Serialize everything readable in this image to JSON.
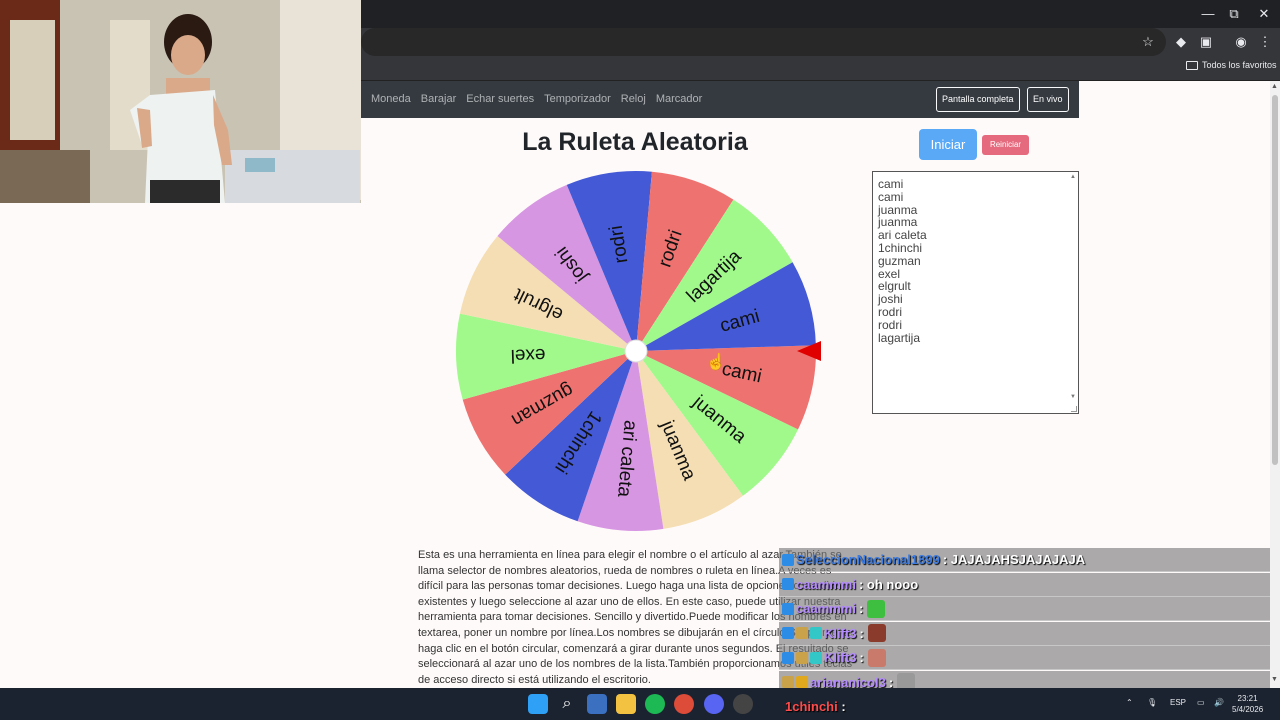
{
  "browser": {
    "win_min": "—",
    "win_max": "⧉",
    "win_close": "✕",
    "bookmarks_label": "Todos los favoritos"
  },
  "navbar": {
    "links": [
      "Moneda",
      "Barajar",
      "Echar suertes",
      "Temporizador",
      "Reloj",
      "Marcador"
    ],
    "fullscreen_label": "Pantalla completa",
    "live_label": "En vivo"
  },
  "main": {
    "title": "La Ruleta Aleatoria",
    "start_label": "Iniciar",
    "reset_label": "Reiniciar",
    "names_text": "cami\ncami\njuanma\njuanma\nari caleta\n1chinchi\nguzman\nexel\nelgrult\njoshi\nrodri\nrodri\nlagartija",
    "description": "Esta es una herramienta en línea para elegir el nombre o el artículo al azar.También se llama selector de nombres aleatorios, rueda de nombres o ruleta en línea.A veces es difícil para las personas tomar decisiones. Luego haga una lista de opciones o candidatos existentes y luego seleccione al azar uno de ellos. En este caso, puede utilizar nuestra herramienta para tomar decisiones. Sencillo y divertido.Puede modificar los nombres en textarea, poner un nombre por línea.Los nombres se dibujarán en el círculo.Simplemente haga clic en el botón circular, comenzará a girar durante unos segundos. El resultado se seleccionará al azar uno de los nombres de la lista.También proporcionamos útiles teclas de acceso directo si está utilizando el escritorio."
  },
  "wheel": {
    "rotation_deg": 12,
    "segments": [
      {
        "label": "cami",
        "color": "#ee7370"
      },
      {
        "label": "juanma",
        "color": "#a1f98c"
      },
      {
        "label": "juanma",
        "color": "#f5deb3"
      },
      {
        "label": "ari caleta",
        "color": "#d796e2"
      },
      {
        "label": "1chinchi",
        "color": "#4359d6"
      },
      {
        "label": "guzman",
        "color": "#ee7370"
      },
      {
        "label": "exel",
        "color": "#a1f98c"
      },
      {
        "label": "elgrult",
        "color": "#f5deb3"
      },
      {
        "label": "joshi",
        "color": "#d796e2"
      },
      {
        "label": "rodri",
        "color": "#4359d6"
      },
      {
        "label": "rodri",
        "color": "#ee7370"
      },
      {
        "label": "lagartija",
        "color": "#a1f98c"
      },
      {
        "label": "cami",
        "color": "#4359d6"
      }
    ],
    "pointer_color": "#e00000"
  },
  "chat": [
    {
      "user": "SeleccionNacional1899",
      "user_color": "#3d7be0",
      "badges": [
        "#2d8ce6"
      ],
      "message": ": JAJAJAHSJAJAJAJA",
      "emote": ""
    },
    {
      "user": "caammmi",
      "user_color": "#b58cff",
      "badges": [
        "#2d8ce6"
      ],
      "message": ": oh nooo",
      "emote": ""
    },
    {
      "user": "caammmi",
      "user_color": "#b58cff",
      "badges": [
        "#2d8ce6"
      ],
      "message": ":",
      "emote": "#3fbf3f"
    },
    {
      "user": "Klift3",
      "user_color": "#b58cff",
      "badges": [
        "#2d8ce6",
        "#c9a24a",
        "#33c7c7"
      ],
      "message": ":",
      "emote": "#8a3b2b"
    },
    {
      "user": "Klift3",
      "user_color": "#b58cff",
      "badges": [
        "#2d8ce6",
        "#c9a24a",
        "#33c7c7"
      ],
      "message": ":",
      "emote": "#c97a6a"
    },
    {
      "user": "ariananicol3",
      "user_color": "#b58cff",
      "badges": [
        "#c9a24a",
        "#e0a81c"
      ],
      "message": ":",
      "emote": "#999999"
    }
  ],
  "taskbar": {
    "chat_user": "1chinchi",
    "chat_sep": ":",
    "lang": "ESP",
    "time": "23:21",
    "date": "5/4/2026"
  }
}
